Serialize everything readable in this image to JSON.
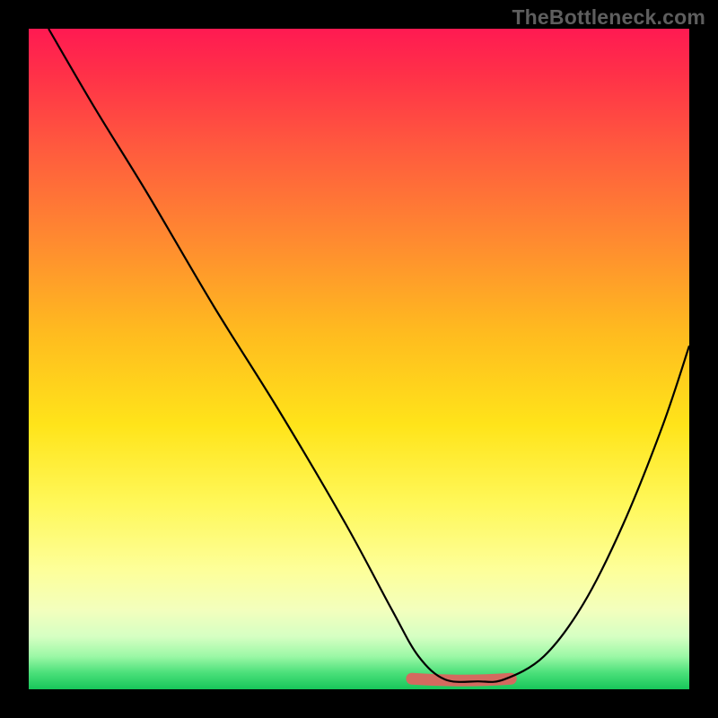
{
  "watermark": "TheBottleneck.com",
  "chart_data": {
    "type": "line",
    "title": "",
    "xlabel": "",
    "ylabel": "",
    "x_range": [
      0,
      100
    ],
    "y_range": [
      0,
      100
    ],
    "grid": false,
    "legend": false,
    "gradient_stops": [
      {
        "pct": 0,
        "color": "#ff1a52"
      },
      {
        "pct": 18,
        "color": "#ff5a3e"
      },
      {
        "pct": 46,
        "color": "#ffbb1f"
      },
      {
        "pct": 72,
        "color": "#fff85a"
      },
      {
        "pct": 92,
        "color": "#d6ffc3"
      },
      {
        "pct": 100,
        "color": "#17c65a"
      }
    ],
    "series": [
      {
        "name": "bottleneck-curve",
        "x": [
          3,
          10,
          18,
          28,
          38,
          48,
          55,
          59,
          63,
          68,
          72,
          78,
          84,
          90,
          96,
          100
        ],
        "y": [
          100,
          88,
          75,
          58,
          42,
          25,
          12,
          5,
          1.5,
          1.2,
          1.5,
          5,
          13,
          25,
          40,
          52
        ]
      }
    ],
    "highlight_segment": {
      "name": "optimal-range",
      "color": "#d46a5f",
      "x": [
        58,
        73
      ],
      "y": [
        1.6,
        1.6
      ]
    }
  }
}
